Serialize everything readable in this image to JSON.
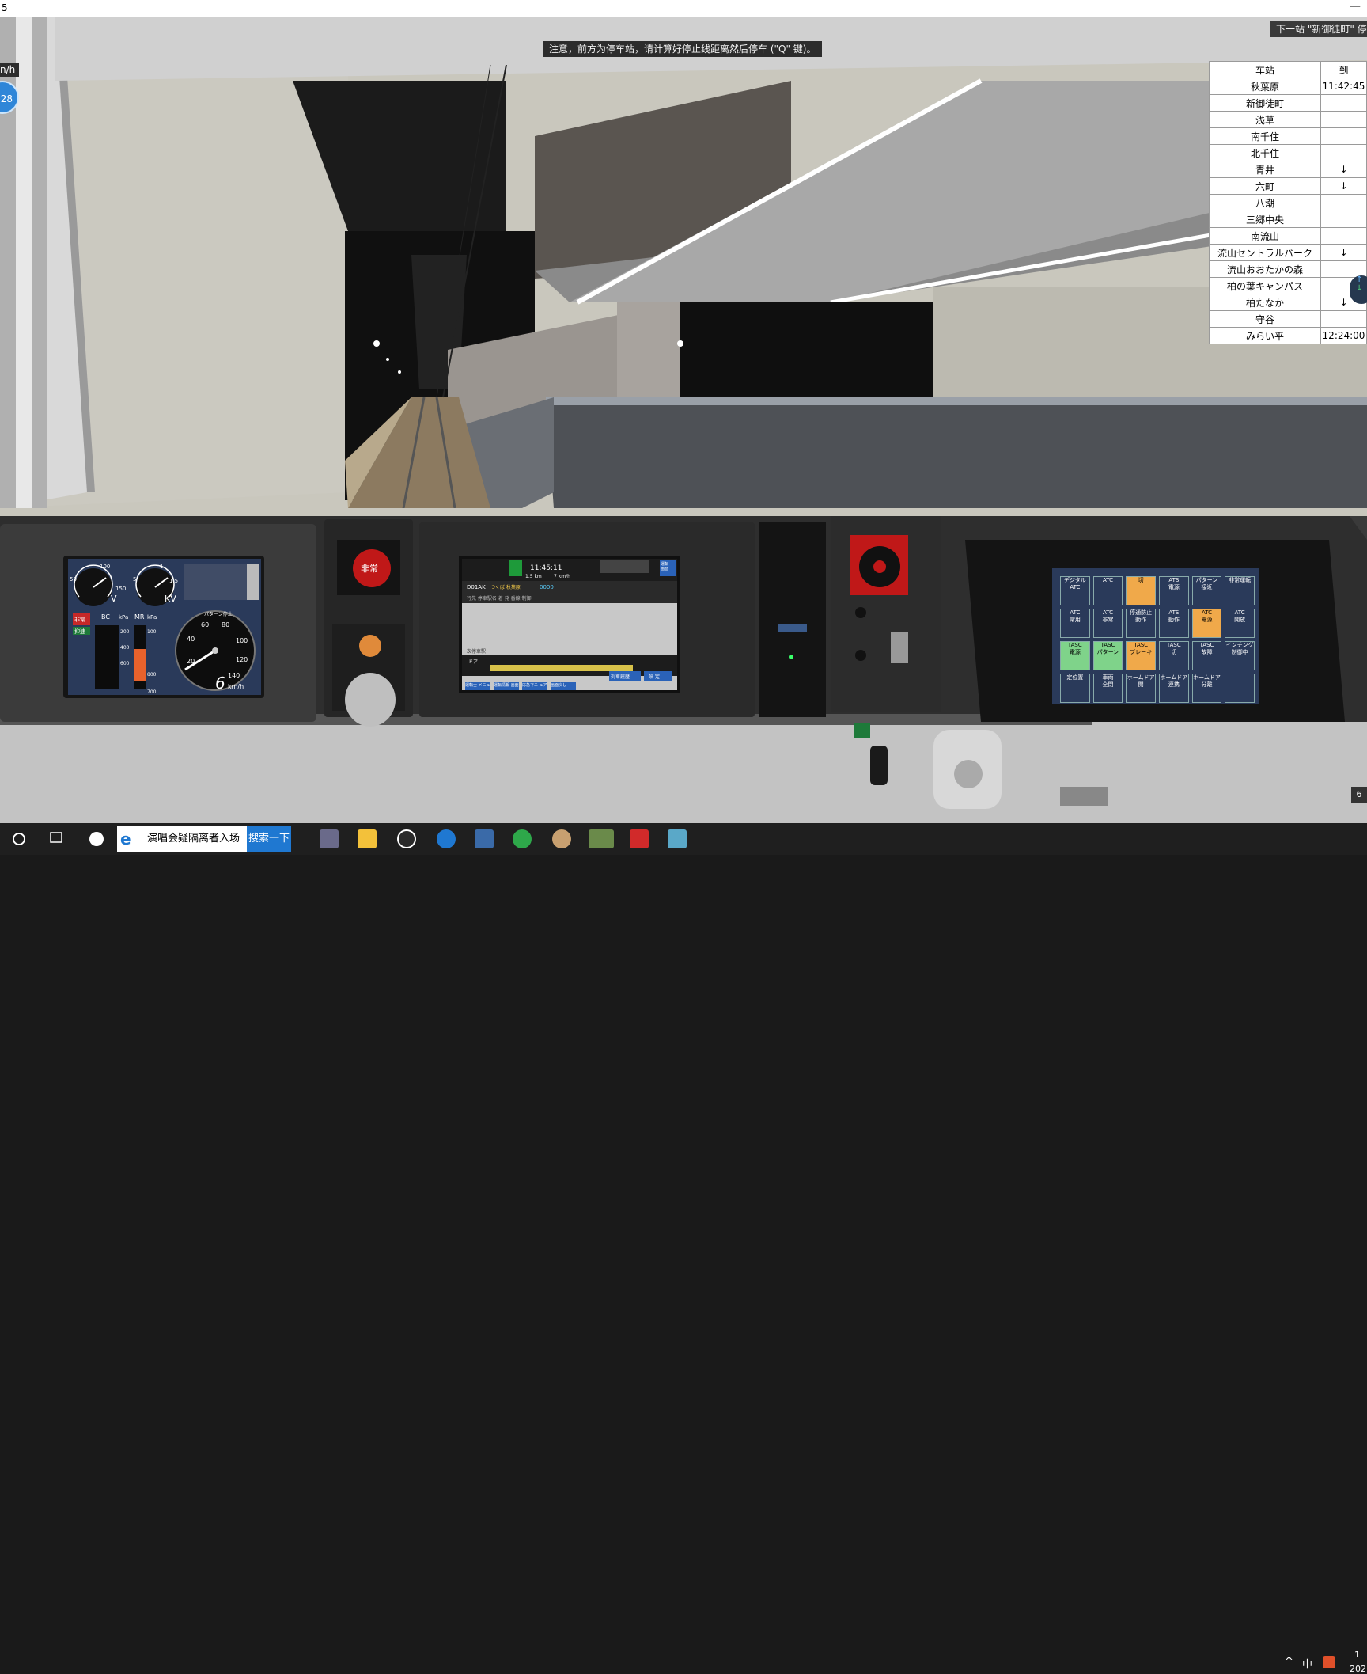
{
  "window": {
    "title": "5",
    "minimize_label": "—"
  },
  "hud": {
    "notice": "注意，前方为停车站，请计算好停止线距离然后停车 (\"Q\" 键)。",
    "next_station": "下一站 \"新御徒町\" 停",
    "speed_unit_fragment": "n/h",
    "speed_value_fragment": "28"
  },
  "timetable": {
    "headers": [
      "车站",
      "到"
    ],
    "rows": [
      {
        "station": "秋葉原",
        "time": "11:42:45"
      },
      {
        "station": "新御徒町",
        "time": ""
      },
      {
        "station": "浅草",
        "time": ""
      },
      {
        "station": "南千住",
        "time": ""
      },
      {
        "station": "北千住",
        "time": ""
      },
      {
        "station": "青井",
        "time": "↓"
      },
      {
        "station": "六町",
        "time": "↓"
      },
      {
        "station": "八潮",
        "time": ""
      },
      {
        "station": "三郷中央",
        "time": ""
      },
      {
        "station": "南流山",
        "time": ""
      },
      {
        "station": "流山セントラルパーク",
        "time": "↓"
      },
      {
        "station": "流山おおたかの森",
        "time": ""
      },
      {
        "station": "柏の葉キャンパス",
        "time": ""
      },
      {
        "station": "柏たなか",
        "time": "↓"
      },
      {
        "station": "守谷",
        "time": ""
      },
      {
        "station": "みらい平",
        "time": "12:24:00"
      }
    ],
    "nav_up": "↑",
    "nav_down": "↓"
  },
  "cab": {
    "gauges": {
      "v_label": "V",
      "kv_label": "KV",
      "v_ticks": [
        "50",
        "100",
        "150"
      ],
      "kv_ticks": [
        "5",
        "1",
        "1.5"
      ],
      "bc_label": "BC",
      "mr_label": "MR",
      "kpa_label": "kPa",
      "speed_unit": "km/h",
      "speed_value": "6",
      "speed_ticks": [
        "20",
        "40",
        "60",
        "80",
        "100",
        "120",
        "140"
      ],
      "pattern_label": "パターン停止",
      "status_1": "非常",
      "status_2": "抑速",
      "bar_ticks": [
        "200",
        "400",
        "600",
        "800",
        "100",
        "700"
      ]
    },
    "emergency_label": "非常",
    "tims": {
      "time": "11:45:11",
      "speed": "7 km/h",
      "distance": "1.5 km",
      "train_no": "D01AK",
      "route": "つくば 秋葉原",
      "car_numbers": "0000",
      "header_row": "行先  停車駅名  着  発  番線  制御",
      "section_title": "次停車駅",
      "door_label": "ドア",
      "btn_history": "列車履歴",
      "btn_settings": "設 定",
      "soft_keys": [
        "運転士\nメニュー",
        "運転情報\n画面",
        "応急マニ\nュアル",
        "画面戻し"
      ],
      "top_btn": "運転\n画面"
    },
    "ats_panel": {
      "buttons": [
        [
          "デジタル\nATC",
          "ATC",
          "切",
          "ATS\n電源",
          "パターン\n接近",
          "非常運転"
        ],
        [
          "ATC\n常用",
          "ATC\n非常",
          "停通防止\n動作",
          "ATS\n動作",
          "ATC\n電源",
          "ATC\n開放"
        ],
        [
          "TASC\n電源",
          "TASC\nパターン",
          "TASC\nブレーキ",
          "TASC\n切",
          "TASC\n故障",
          "インチング\n制御中"
        ],
        [
          "定位置",
          "車両\n全閉",
          "ホームドア\n開",
          "ホームドア\n連携",
          "ホームドア\n分離",
          ""
        ]
      ]
    }
  },
  "taskbar": {
    "search_text": "演唱会疑隔离者入场",
    "search_button": "搜索一下",
    "tray_ime": "中",
    "tray_year": "202",
    "tray_time": "1"
  },
  "corner_badge": "6",
  "colors": {
    "sky_blue": "#2f86d8",
    "ats_green": "#7fd38a",
    "ats_orange": "#f0a94a",
    "ats_panel": "#2a3a5a",
    "emergency_red": "#c01818"
  }
}
